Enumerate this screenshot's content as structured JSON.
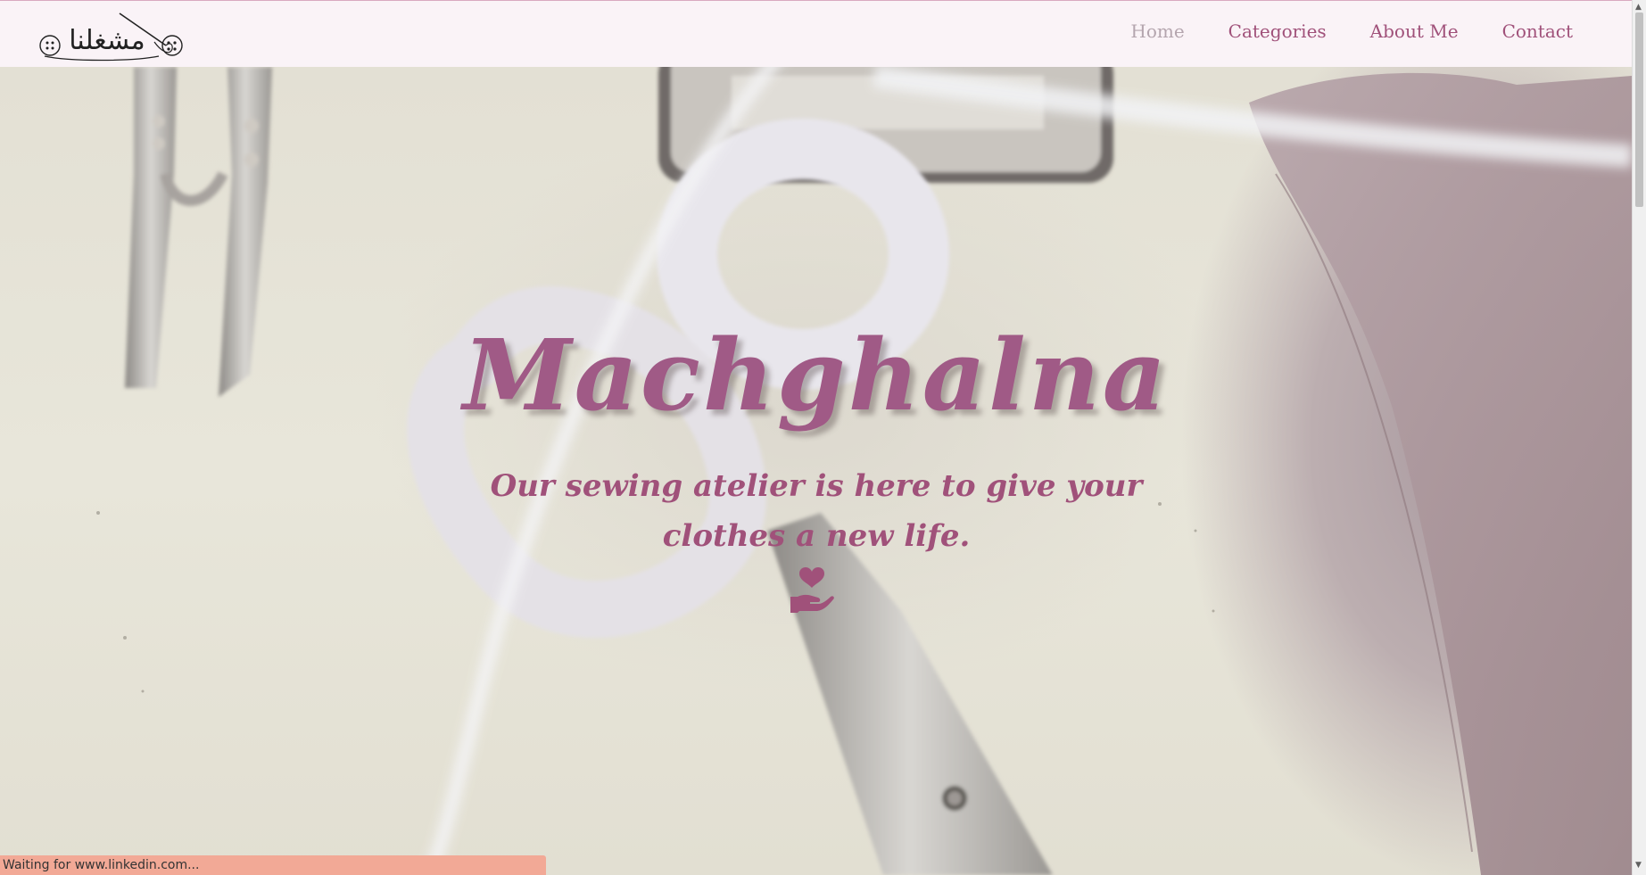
{
  "brand": {
    "logo_alt": "مشغلنا",
    "logo_text": "مشغلنا",
    "accent_color": "#a0517a"
  },
  "nav": {
    "items": [
      {
        "label": "Home",
        "active": true
      },
      {
        "label": "Categories",
        "active": false
      },
      {
        "label": "About Me",
        "active": false
      },
      {
        "label": "Contact",
        "active": false
      }
    ]
  },
  "hero": {
    "title": "Machghalna",
    "subtitle": "Our sewing atelier is here to give your clothes a new life.",
    "icon": "hand-holding-heart-icon",
    "background": "sewing-scissors-photo"
  },
  "status_bar": {
    "text": "Waiting for www.linkedin.com..."
  }
}
